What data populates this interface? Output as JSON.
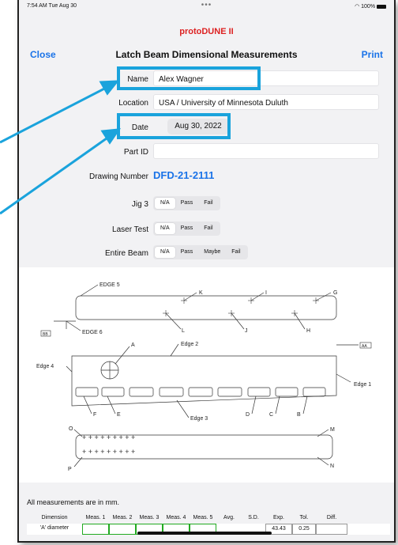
{
  "status": {
    "time": "7:54 AM  Tue Aug 30",
    "dots": "•••",
    "battery": "100%"
  },
  "app_title": "protoDUNE II",
  "nav": {
    "close": "Close",
    "title": "Latch Beam Dimensional Measurements",
    "print": "Print"
  },
  "form": {
    "name_label": "Name",
    "name_value": "Alex Wagner",
    "location_label": "Location",
    "location_value": "USA / University of Minnesota Duluth",
    "date_label": "Date",
    "date_value": "Aug 30, 2022",
    "partid_label": "Part ID",
    "partid_value": "",
    "drawing_label": "Drawing Number",
    "drawing_value": "DFD-21-2111"
  },
  "tests": {
    "jig3": {
      "label": "Jig 3",
      "options": [
        "N/A",
        "Pass",
        "Fail"
      ],
      "selected": "N/A"
    },
    "laser": {
      "label": "Laser Test",
      "options": [
        "N/A",
        "Pass",
        "Fail"
      ],
      "selected": "N/A"
    },
    "beam": {
      "label": "Entire Beam",
      "options": [
        "N/A",
        "Pass",
        "Maybe",
        "Fail"
      ],
      "selected": "N/A"
    }
  },
  "drawing_labels": {
    "edge5": "EDGE 5",
    "edge6": "EDGE 6",
    "k": "K",
    "i": "I",
    "g": "G",
    "l": "L",
    "j": "J",
    "h": "H",
    "bb": "BB",
    "a": "A",
    "edge2": "Edge 2",
    "edge4": "Edge 4",
    "aa": "AA",
    "edge1": "Edge 1",
    "f": "F",
    "e": "E",
    "d": "D",
    "c": "C",
    "b": "B",
    "edge3": "Edge 3",
    "o": "O",
    "m": "M",
    "p": "P",
    "n": "N"
  },
  "measure_note": "All measurements are in mm.",
  "table": {
    "headers": [
      "Dimension",
      "Meas. 1",
      "Meas. 2",
      "Meas. 3",
      "Meas. 4",
      "Meas. 5",
      "Avg.",
      "S.D.",
      "Exp.",
      "Tol.",
      "Diff."
    ],
    "row": {
      "dimension": "'A' diameter",
      "exp": "43.43",
      "tol": "0.25"
    }
  }
}
